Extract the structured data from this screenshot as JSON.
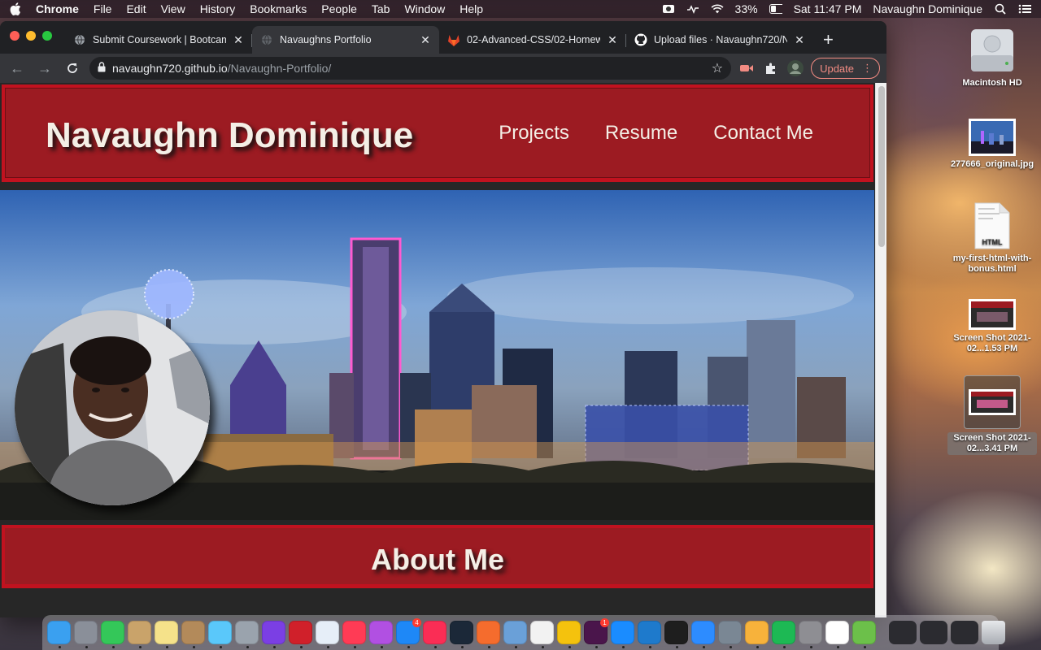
{
  "menubar": {
    "app_name": "Chrome",
    "items": [
      "File",
      "Edit",
      "View",
      "History",
      "Bookmarks",
      "People",
      "Tab",
      "Window",
      "Help"
    ],
    "battery": "33%",
    "clock": "Sat 11:47 PM",
    "user": "Navaughn Dominique"
  },
  "browser": {
    "tabs": [
      {
        "title": "Submit Coursework | Bootcam",
        "icon": "globe-icon",
        "active": false
      },
      {
        "title": "Navaughns Portfolio",
        "icon": "globe-icon",
        "active": true
      },
      {
        "title": "02-Advanced-CSS/02-Homew",
        "icon": "gitlab-icon",
        "active": false
      },
      {
        "title": "Upload files · Navaughn720/N",
        "icon": "github-icon",
        "active": false
      }
    ],
    "url_host": "navaughn720.github.io",
    "url_path": "/Navaughn-Portfolio/",
    "update_label": "Update"
  },
  "page": {
    "site_name": "Navaughn Dominique",
    "nav": [
      "Projects",
      "Resume",
      "Contact Me"
    ],
    "about_title": "About Me"
  },
  "desktop": {
    "icons": [
      {
        "label": "Macintosh HD",
        "icon": "harddrive-icon"
      },
      {
        "label": "277666_original.jpg",
        "icon": "image-file-icon"
      },
      {
        "label": "my-first-html-with-bonus.html",
        "icon": "html-file-icon",
        "badge": "HTML"
      },
      {
        "label": "Screen Shot 2021-02...1.53 PM",
        "icon": "screenshot-icon"
      },
      {
        "label": "Screen Shot 2021-02...3.41 PM",
        "icon": "screenshot-icon"
      }
    ]
  },
  "dock": {
    "apps": [
      {
        "name": "finder-icon",
        "color": "#3aa0f0"
      },
      {
        "name": "launchpad-icon",
        "color": "#8a8f99"
      },
      {
        "name": "facetime-icon",
        "color": "#34c759"
      },
      {
        "name": "notes-icon",
        "color": "#c9a36a"
      },
      {
        "name": "stickies-icon",
        "color": "#f5e28a"
      },
      {
        "name": "contacts-icon",
        "color": "#b38a5a"
      },
      {
        "name": "messages-icon",
        "color": "#5ac8fa"
      },
      {
        "name": "disk-utility-icon",
        "color": "#9aa3ad"
      },
      {
        "name": "imovie-icon",
        "color": "#7b3fe4"
      },
      {
        "name": "reader-icon",
        "color": "#d0202a"
      },
      {
        "name": "mail-icon",
        "color": "#e6eef8"
      },
      {
        "name": "news-icon",
        "color": "#ff3b55"
      },
      {
        "name": "podcasts-icon",
        "color": "#b150e2"
      },
      {
        "name": "app-store-icon",
        "color": "#1e88f7",
        "badge": "4"
      },
      {
        "name": "music-icon",
        "color": "#fa2d55"
      },
      {
        "name": "steam-icon",
        "color": "#1b2838"
      },
      {
        "name": "origin-icon",
        "color": "#f56c2d"
      },
      {
        "name": "preview-icon",
        "color": "#6aa0d8"
      },
      {
        "name": "textedit-icon",
        "color": "#f2f2f2"
      },
      {
        "name": "chrome-icon",
        "color": "#f4c20d"
      },
      {
        "name": "slack-icon",
        "color": "#4a154b",
        "badge": "1"
      },
      {
        "name": "safari-icon",
        "color": "#1a8cff"
      },
      {
        "name": "vscode-icon",
        "color": "#1e7acc"
      },
      {
        "name": "terminal-icon",
        "color": "#1e1e1e"
      },
      {
        "name": "zoom-icon",
        "color": "#2d8cff"
      },
      {
        "name": "system-info-icon",
        "color": "#7a8794"
      },
      {
        "name": "photos-icon",
        "color": "#f7b23b"
      },
      {
        "name": "spotify-icon",
        "color": "#1db954"
      },
      {
        "name": "system-preferences-icon",
        "color": "#8e8e93"
      },
      {
        "name": "calendar-icon",
        "color": "#ffffff"
      },
      {
        "name": "maps-icon",
        "color": "#6cc04a"
      }
    ],
    "recent": [
      "downloads-stack-icon",
      "screenshot-stack-icon",
      "window-stack-icon"
    ],
    "trash": "trash-icon"
  }
}
